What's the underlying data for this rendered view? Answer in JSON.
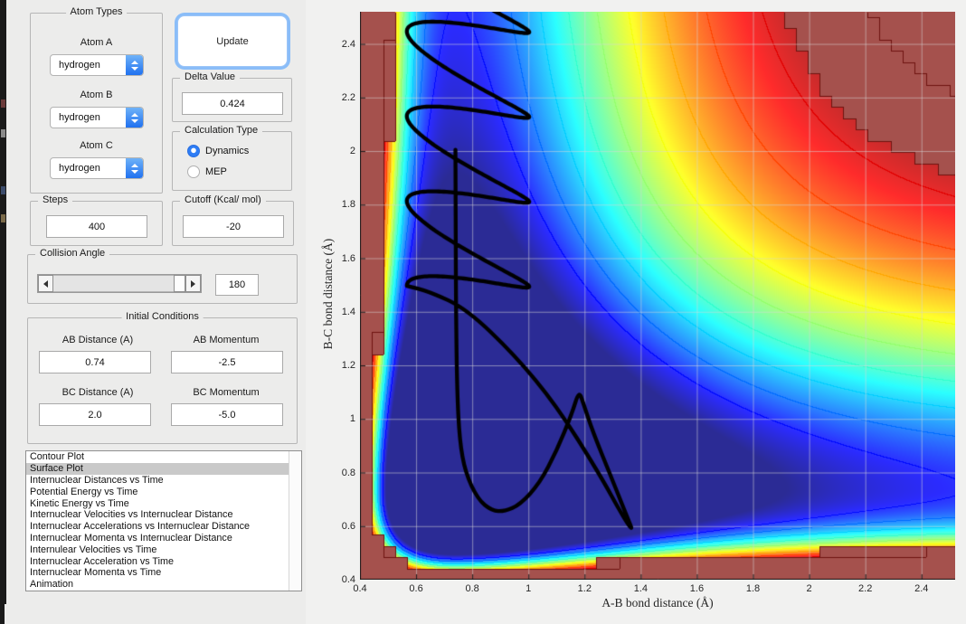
{
  "panels": {
    "atom_types": {
      "title": "Atom Types",
      "items": [
        {
          "label": "Atom A",
          "value": "hydrogen"
        },
        {
          "label": "Atom B",
          "value": "hydrogen"
        },
        {
          "label": "Atom C",
          "value": "hydrogen"
        }
      ]
    },
    "update_button": "Update",
    "delta": {
      "title": "Delta Value",
      "value": "0.424"
    },
    "calc_type": {
      "title": "Calculation Type",
      "options": [
        {
          "label": "Dynamics",
          "selected": true
        },
        {
          "label": "MEP",
          "selected": false
        }
      ]
    },
    "steps": {
      "title": "Steps",
      "value": "400"
    },
    "cutoff": {
      "title": "Cutoff (Kcal/ mol)",
      "value": "-20"
    },
    "collision": {
      "title": "Collision Angle",
      "value": "180"
    },
    "initial": {
      "title": "Initial Conditions",
      "fields": [
        {
          "label": "AB Distance (A)",
          "value": "0.74"
        },
        {
          "label": "AB Momentum",
          "value": "-2.5"
        },
        {
          "label": "BC Distance (A)",
          "value": "2.0"
        },
        {
          "label": "BC Momentum",
          "value": "-5.0"
        }
      ]
    },
    "plot_list": {
      "selected_index": 1,
      "items": [
        "Contour Plot",
        "Surface Plot",
        "Internuclear Distances vs Time",
        "Potential Energy vs Time",
        "Kinetic Energy vs Time",
        "Internuclear Velocities vs Internuclear Distance",
        "Internuclear Accelerations vs Internuclear Distance",
        "Internuclear Momenta vs Internuclear Distance",
        "Internulear Velocities vs Time",
        "Internuclear Acceleration vs Time",
        "Internuclear Momenta vs Time",
        "Animation"
      ]
    }
  },
  "plot": {
    "xlabel": "A-B bond distance (Å)",
    "ylabel": "B-C bond distance (Å)",
    "x_range": [
      0.4,
      2.52
    ],
    "y_range": [
      0.4,
      2.52
    ],
    "x_ticks": [
      0.4,
      0.6,
      0.8,
      1,
      1.2,
      1.4,
      1.6,
      1.8,
      2,
      2.2,
      2.4
    ],
    "x_tick_labels": [
      "0.4",
      "0.6",
      "0.8",
      "1",
      "1.2",
      "1.4",
      "1.6",
      "1.8",
      "2",
      "2.2",
      "2.4"
    ],
    "y_ticks": [
      0.4,
      0.6,
      0.8,
      1,
      1.2,
      1.4,
      1.6,
      1.8,
      2,
      2.2,
      2.4
    ],
    "y_tick_labels": [
      "0.4",
      "0.6",
      "0.8",
      "1",
      "1.2",
      "1.4",
      "1.6",
      "1.8",
      "2",
      "2.2",
      "2.4"
    ],
    "grid": true,
    "colormap": "jet",
    "grid_color": "rgba(215,215,215,0.55)",
    "surface": {
      "model": "morse-sum LEPS-like",
      "D": 104,
      "r0": 0.74,
      "a_in": 2.6,
      "a_out": 1.94,
      "vmin": -124,
      "vmax": -20,
      "clip": -28,
      "coarse_step": 0.042,
      "clip_fill": "#a5514d",
      "clip_line": "#6e1310",
      "inner_clip_level": -19,
      "contour_levels": [
        -110,
        -100,
        -90,
        -80,
        -70,
        -60,
        -50,
        -40,
        -30
      ],
      "fill_lighten": 0.17
    },
    "trajectory": {
      "color": "#000000",
      "width": 4.3,
      "incoming": [
        [
          0.74,
          2.005
        ],
        [
          0.741,
          1.7
        ],
        [
          0.742,
          1.4
        ],
        [
          0.746,
          1.1
        ],
        [
          0.755,
          0.92
        ],
        [
          0.775,
          0.8
        ],
        [
          0.82,
          0.7
        ],
        [
          0.87,
          0.657
        ],
        [
          0.915,
          0.655
        ],
        [
          0.97,
          0.68
        ],
        [
          1.04,
          0.76
        ],
        [
          1.1,
          0.88
        ],
        [
          1.155,
          1.02
        ],
        [
          1.18,
          1.105
        ],
        [
          1.195,
          1.06
        ],
        [
          1.23,
          0.95
        ],
        [
          1.3,
          0.77
        ],
        [
          1.355,
          0.625
        ],
        [
          1.372,
          0.582
        ],
        [
          1.34,
          0.63
        ],
        [
          1.25,
          0.8
        ],
        [
          1.1,
          1.05
        ],
        [
          0.95,
          1.24
        ],
        [
          0.78,
          1.41
        ],
        [
          0.65,
          1.475
        ],
        [
          0.567,
          1.497
        ]
      ],
      "outgoing_epicycle": {
        "ab_center": 0.785,
        "ab_amp": 0.218,
        "bc_base": 1.4163,
        "bc_rate": 0.0504,
        "bc_amp": 0.085,
        "phase": 1.25,
        "theta_end": 24.0
      }
    }
  }
}
